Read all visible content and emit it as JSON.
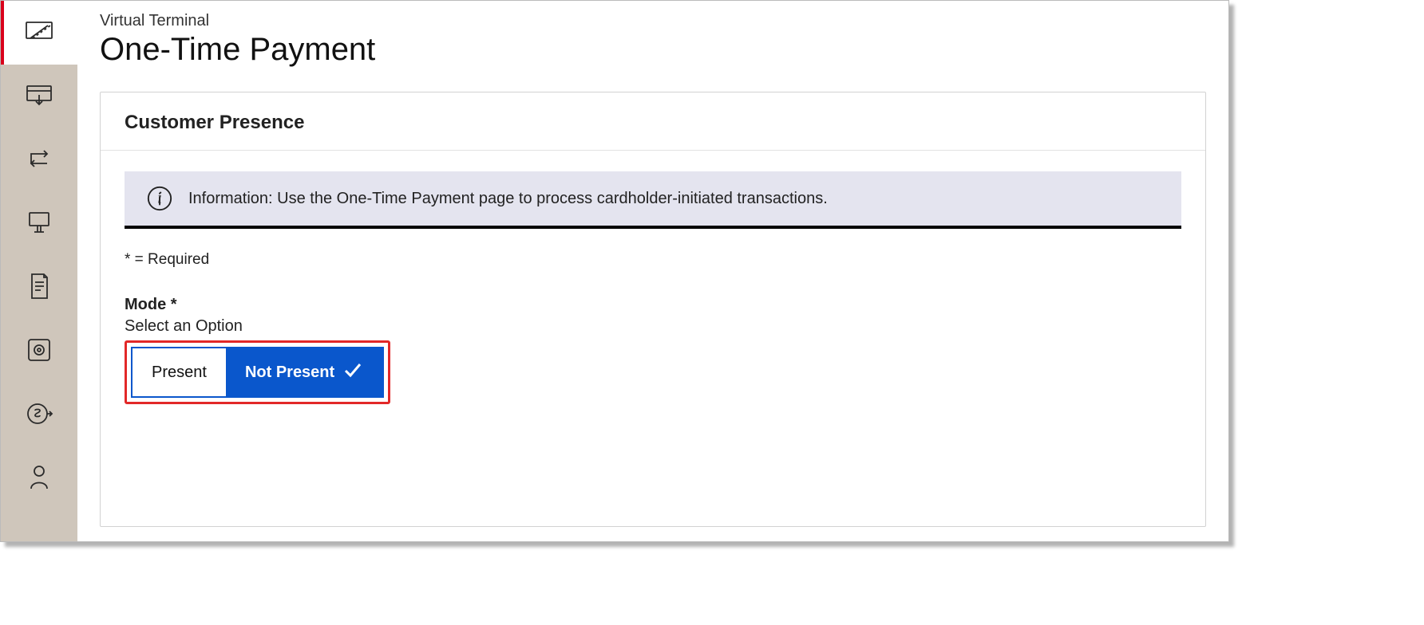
{
  "header": {
    "breadcrumb": "Virtual Terminal",
    "title": "One-Time Payment"
  },
  "sidebar": {
    "items": [
      {
        "name": "terminal",
        "active": true
      },
      {
        "name": "deposit",
        "active": false
      },
      {
        "name": "transfer",
        "active": false
      },
      {
        "name": "reader",
        "active": false
      },
      {
        "name": "receipt",
        "active": false
      },
      {
        "name": "settings",
        "active": false
      },
      {
        "name": "payout",
        "active": false
      },
      {
        "name": "profile",
        "active": false
      }
    ]
  },
  "card": {
    "heading": "Customer Presence",
    "info_message": "Information: Use the One-Time Payment page to process cardholder-initiated transactions.",
    "required_note": "* = Required",
    "mode": {
      "label": "Mode *",
      "helper": "Select an Option",
      "options": [
        {
          "label": "Present",
          "selected": false
        },
        {
          "label": "Not Present",
          "selected": true
        }
      ]
    }
  }
}
